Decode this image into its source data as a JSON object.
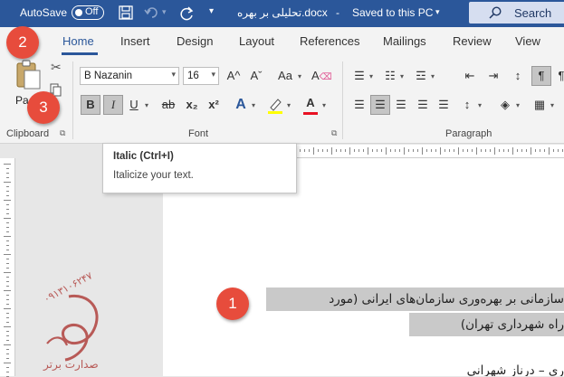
{
  "titlebar": {
    "autosave_label": "AutoSave",
    "autosave_state": "Off",
    "doc_title": "تحلیلی بر بهره.docx",
    "saved_status": "Saved to this PC",
    "search_label": "Search"
  },
  "tabs": [
    "Home",
    "Insert",
    "Design",
    "Layout",
    "References",
    "Mailings",
    "Review",
    "View"
  ],
  "ribbon": {
    "clipboard_label": "Clipboard",
    "paste_label": "Pa",
    "font_group_label": "Font",
    "paragraph_group_label": "Paragraph",
    "font_name": "B Nazanin",
    "font_size": "16",
    "bold": "B",
    "italic": "I",
    "underline": "U",
    "strike": "ab",
    "sub": "x₂",
    "sup": "x²",
    "grow": "A^",
    "shrink": "Aˇ",
    "case": "Aa",
    "text_effects": "A",
    "font_color": "A"
  },
  "tooltip": {
    "title": "Italic (Ctrl+I)",
    "description": "Italicize your text."
  },
  "callouts": [
    "1",
    "2",
    "3"
  ],
  "document": {
    "line1": "سازمانی بر بهره‌وری سازمان‌های ایرانی (مورد",
    "line2": "راه شهرداری تهران)",
    "line3": "ری – درناز شهرانی"
  },
  "watermark": {
    "phone": "۰۹۱۳۱۰۶۲۴۷",
    "name": "صدارت برتر"
  },
  "colors": {
    "brand_blue": "#2b579a",
    "callout_red": "#e74c3c",
    "highlight_yellow": "#ffff00",
    "font_red": "#e81123",
    "selection_gray": "#c9c9c9"
  }
}
